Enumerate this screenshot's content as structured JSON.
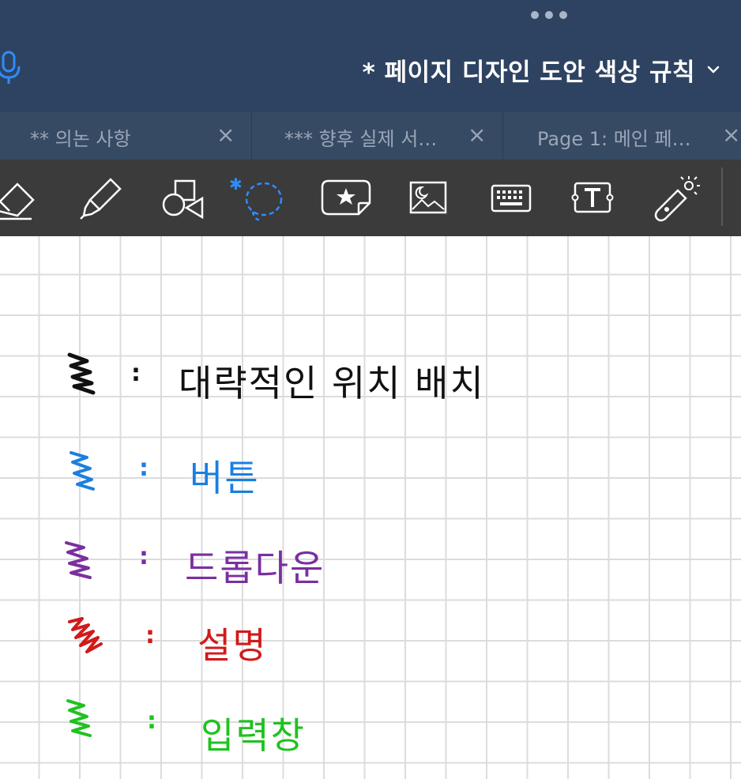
{
  "header": {
    "title": "* 페이지 디자인 도안 색상 규칙"
  },
  "tabs": [
    {
      "label": "** 의논 사항"
    },
    {
      "label": "*** 향후 실제 서…"
    },
    {
      "label": "Page 1: 메인 페…"
    }
  ],
  "close_glyph": "×",
  "toolbar": {
    "tools": [
      "eraser-icon",
      "highlighter-icon",
      "shapes-icon",
      "lasso-icon",
      "sticker-icon",
      "image-icon",
      "keyboard-icon",
      "text-box-icon",
      "laser-pointer-icon"
    ]
  },
  "legend": [
    {
      "label": "대략적인 위치 배치",
      "color": "#111111"
    },
    {
      "label": "버튼",
      "color": "#1a7fe0"
    },
    {
      "label": "드롭다운",
      "color": "#7a2fa0"
    },
    {
      "label": "설명",
      "color": "#d11a1a"
    },
    {
      "label": "입력창",
      "color": "#1fc21f"
    }
  ],
  "colon": ":",
  "colors": {
    "header_bg": "#2e4361",
    "tabbar_bg": "#364a64",
    "toolbar_bg": "#3b3b3b",
    "accent": "#2f8cff"
  }
}
